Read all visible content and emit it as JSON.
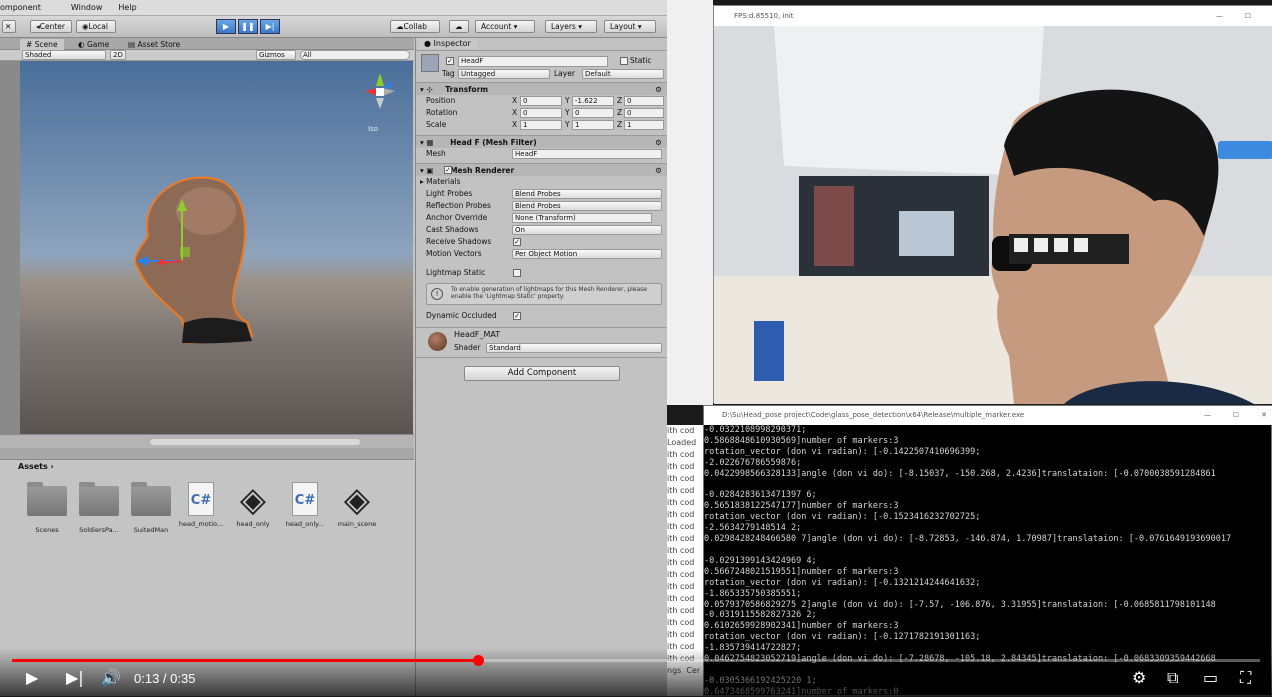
{
  "unity": {
    "menu": [
      "omponent",
      "Window",
      "Help"
    ],
    "toolbar": {
      "pivot": "Center",
      "space": "Local",
      "collab": "Collab",
      "account": "Account",
      "layers": "Layers",
      "layout": "Layout"
    },
    "scene_tabs": [
      "Scene",
      "Game",
      "Asset Store"
    ],
    "scene_bar": {
      "shading": "Shaded",
      "mode2d": "2D",
      "gizmos": "Gizmos",
      "search": "All"
    },
    "gizmo_label": "Iso",
    "inspector": {
      "tab": "Inspector",
      "object_name": "HeadF",
      "static_label": "Static",
      "tag_label": "Tag",
      "tag_value": "Untagged",
      "layer_label": "Layer",
      "layer_value": "Default",
      "transform": {
        "title": "Transform",
        "rows": [
          {
            "label": "Position",
            "x": "0",
            "y": "-1.622",
            "z": "0"
          },
          {
            "label": "Rotation",
            "x": "0",
            "y": "0",
            "z": "0"
          },
          {
            "label": "Scale",
            "x": "1",
            "y": "1",
            "z": "1"
          }
        ]
      },
      "mesh_filter": {
        "title": "Head F (Mesh Filter)",
        "mesh_label": "Mesh",
        "mesh_value": "HeadF"
      },
      "mesh_renderer": {
        "title": "Mesh Renderer",
        "materials": "Materials",
        "light_probes": {
          "label": "Light Probes",
          "value": "Blend Probes"
        },
        "reflection_probes": {
          "label": "Reflection Probes",
          "value": "Blend Probes"
        },
        "anchor_override": {
          "label": "Anchor Override",
          "value": "None (Transform)"
        },
        "cast_shadows": {
          "label": "Cast Shadows",
          "value": "On"
        },
        "receive_shadows": "Receive Shadows",
        "motion_vectors": {
          "label": "Motion Vectors",
          "value": "Per Object Motion"
        },
        "lightmap_static": "Lightmap Static",
        "info": "To enable generation of lightmaps for this Mesh Renderer, please enable the 'Lightmap Static' property.",
        "dynamic_occluded": "Dynamic Occluded"
      },
      "material": {
        "name": "HeadF_MAT",
        "shader_label": "Shader",
        "shader_value": "Standard"
      },
      "add_component": "Add Component"
    },
    "assets": {
      "tab": "Assets",
      "items": [
        {
          "name": "Scenes",
          "kind": "folder"
        },
        {
          "name": "SoldiersPa...",
          "kind": "folder"
        },
        {
          "name": "SuitedMan",
          "kind": "folder"
        },
        {
          "name": "head_motio...",
          "kind": "cs"
        },
        {
          "name": "head_only",
          "kind": "unity"
        },
        {
          "name": "head_only...",
          "kind": "cs"
        },
        {
          "name": "main_scene",
          "kind": "unity"
        }
      ]
    }
  },
  "camera_window": {
    "title": "FPS:d.85510, init"
  },
  "console_window": {
    "title": "D:\\Su\\Head_pose project\\Code\\glass_pose_detection\\x64\\Release\\multiple_marker.exe",
    "lines": [
      "-0.0322108998290371;",
      "0.5868848610930569]number of markers:3",
      "rotation_vector (don vi radian): [-0.1422507410696399;",
      "-2.022676786559876;",
      "0.0422998566328133]angle (don vi do): [-8.15037, -150.268, 2.4236]translataion: [-0.0700038591284861",
      "",
      "-0.0284283613471397 6;",
      "0.5651838122547177]number of markers:3",
      "rotation_vector (don vi radian): [-0.1523416232702725;",
      "-2.5634279148514 2;",
      "0.0298428248466580 7]angle (don vi do): [-8.72853, -146.874, 1.70987]translataion: [-0.0761649193690017",
      "",
      "-0.0291399143424969 4;",
      "0.5667248021519551]number of markers:3",
      "rotation_vector (don vi radian): [-0.1321214244641632;",
      "-1.865335750385551;",
      "0.0579370586829275 2]angle (don vi do): [-7.57, -106.876, 3.31955]translataion: [-0.0685811798101148",
      "-0.0319115582827326 2;",
      "0.6102659928902341]number of markers:3",
      "rotation_vector (don vi radian): [-0.1271782191301163;",
      "-1.835739414722827;",
      "0.0462754823052719]angle (don vi do): [-7.28678, -105.18, 2.84345]translataion: [-0.0683309359442668",
      "",
      "-0.0305366192425220 1;",
      "0.6473468599763241]number of markers:0"
    ]
  },
  "code_strip": [
    "ith cod",
    "Loaded",
    "ith cod",
    "ith cod",
    "ith cod",
    "ith cod",
    "ith cod",
    "ith cod",
    "ith cod",
    "ith cod",
    "ith cod",
    "ith cod",
    "ith cod",
    "ith cod",
    "ith cod",
    "ith cod",
    "ith cod",
    "ith cod",
    "ith cod",
    "ith cod",
    "ngs  Cer"
  ],
  "video": {
    "time": "0:13 / 0:35",
    "progress": 0.373
  }
}
